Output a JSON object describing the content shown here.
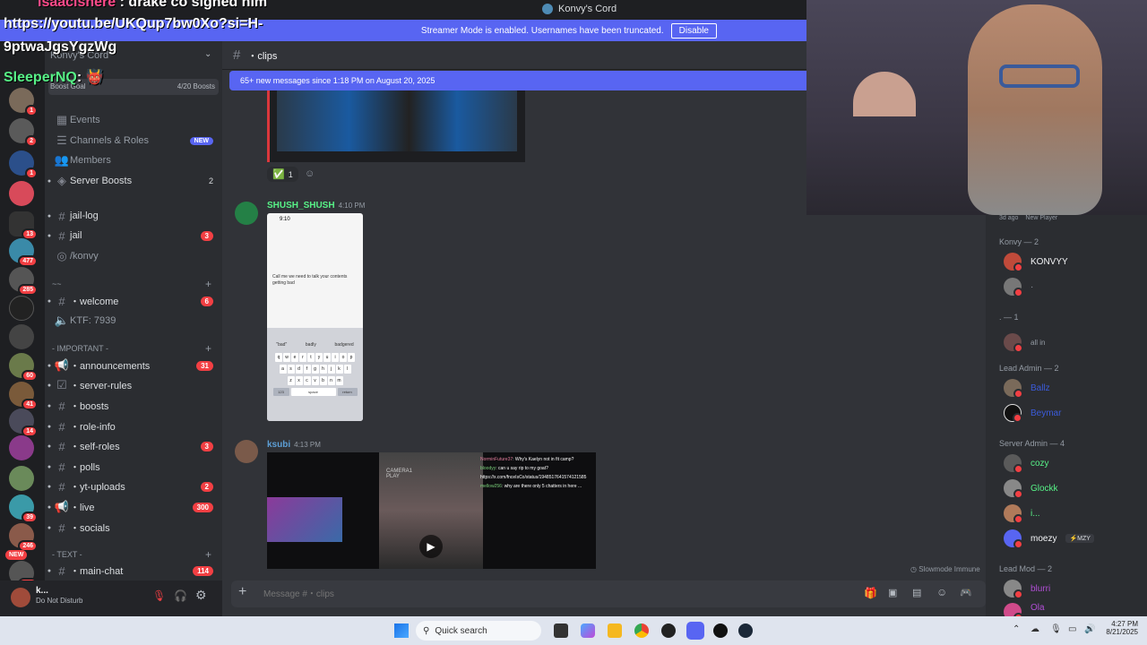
{
  "window": {
    "title": "Konvy's Cord"
  },
  "overlay": {
    "line1_user": "isaacishere",
    "line1_text": ": drake co signed him",
    "line2": "https://youtu.be/UKQup7bw0Xo?si=H-",
    "line3": "9ptwaJgsYgzWg",
    "line4_user": "SleeperNQ",
    "line4_text": ":"
  },
  "banner": {
    "text": "Streamer Mode is enabled. Usernames have been truncated.",
    "button": "Disable"
  },
  "rail": {
    "badges": [
      "1",
      "2",
      "1",
      "13",
      "477",
      "285",
      "60",
      "41",
      "14",
      "39",
      "246",
      "NEW",
      "612"
    ]
  },
  "sidebar": {
    "server_name": "Konvy's Cord",
    "boost_goal": "Boost Goal",
    "boost_count": "4/20 Boosts",
    "items": [
      {
        "label": "Events"
      },
      {
        "label": "Channels & Roles",
        "tag": "NEW"
      },
      {
        "label": "Members"
      },
      {
        "label": "Server Boosts",
        "count": "2"
      },
      {
        "label": "jail-log"
      },
      {
        "label": "jail",
        "count": "3"
      },
      {
        "label": "/konvy"
      },
      {
        "label": "・welcome",
        "count": "6"
      },
      {
        "label": "KTF: 7939"
      },
      {
        "label": "・announcements",
        "count": "31"
      },
      {
        "label": "・server-rules"
      },
      {
        "label": "・boosts"
      },
      {
        "label": "・role-info"
      },
      {
        "label": "・self-roles",
        "count": "3"
      },
      {
        "label": "・polls"
      },
      {
        "label": "・yt-uploads",
        "count": "2"
      },
      {
        "label": "・live",
        "count": "300"
      },
      {
        "label": "・socials"
      },
      {
        "label": "・main-chat",
        "count": "114"
      }
    ],
    "categories": {
      "c1": "~~",
      "c2": "- IMPORTANT -",
      "c3": "- TEXT -"
    }
  },
  "user": {
    "name": "k...",
    "status": "Do Not Disturb"
  },
  "chat": {
    "channel": "・clips",
    "new_messages": "65+ new messages since 1:18 PM on August 20, 2025",
    "reaction_count": "1",
    "msg1": {
      "author": "SHUSH_SHUSH",
      "time": "4:10 PM"
    },
    "msg2": {
      "author": "ksubi",
      "time": "4:13 PM"
    },
    "phone": {
      "clock": "9:10",
      "note": "Call me we need to talk your contents getting bad",
      "suggestions": [
        "\"bad\"",
        "badly",
        "badgered"
      ],
      "row1": [
        "q",
        "w",
        "e",
        "r",
        "t",
        "y",
        "u",
        "i",
        "o",
        "p"
      ],
      "row2": [
        "a",
        "s",
        "d",
        "f",
        "g",
        "h",
        "j",
        "k",
        "l"
      ],
      "row3": [
        "z",
        "x",
        "c",
        "v",
        "b",
        "n",
        "m"
      ],
      "space": "space",
      "return": "return",
      "num": "123"
    },
    "embed_chat": [
      {
        "user": "NorminFuture37",
        "text": "Why's Kaelyn not in fit camp?"
      },
      {
        "user": "bloodyy",
        "text": "can u say rip to my goat?"
      },
      {
        "user": "",
        "text": "https://x.com/fnceIsCo/status/1948517641574121585"
      },
      {
        "user": "mellow256",
        "text": "why are there only 5 chatters in here ..."
      }
    ],
    "embed_label": "CAMERA1 PLAY",
    "slowmode": "Slowmode Immune",
    "placeholder": "Message #・clips"
  },
  "members": {
    "top_meta": "3d ago",
    "top_meta2": "New Player",
    "groups": [
      {
        "title": "Konvy — 2",
        "members": [
          {
            "name": "KONVYY",
            "color": "#f2f3f5"
          },
          {
            "name": "·",
            "color": "#949ba4"
          }
        ]
      },
      {
        "title": ". — 1",
        "members": [
          {
            "name": "all in",
            "color": "#949ba4"
          }
        ]
      },
      {
        "title": "Lead Admin — 2",
        "members": [
          {
            "name": "Ballz",
            "color": "#3b5bdb"
          },
          {
            "name": "Beymar",
            "color": "#3b5bdb"
          }
        ]
      },
      {
        "title": "Server Admin — 4",
        "members": [
          {
            "name": "cozy",
            "color": "#57f287"
          },
          {
            "name": "Glockk",
            "color": "#57f287"
          },
          {
            "name": "i...",
            "color": "#57f287"
          },
          {
            "name": "moezy",
            "color": "#f2f3f5"
          }
        ]
      },
      {
        "title": "Lead Mod — 2",
        "members": [
          {
            "name": "blurri",
            "color": "#b14ed6"
          },
          {
            "name": "Ola",
            "color": "#b14ed6"
          }
        ]
      }
    ],
    "moezy_tag": "MZY"
  },
  "taskbar": {
    "search": "Quick search",
    "time": "4:27 PM",
    "date": "8/21/2025"
  },
  "colors": {
    "blurple": "#5865f2",
    "danger": "#f23f43",
    "rail": "#1e1f22",
    "sidebar": "#2b2d31",
    "chat": "#313338"
  }
}
